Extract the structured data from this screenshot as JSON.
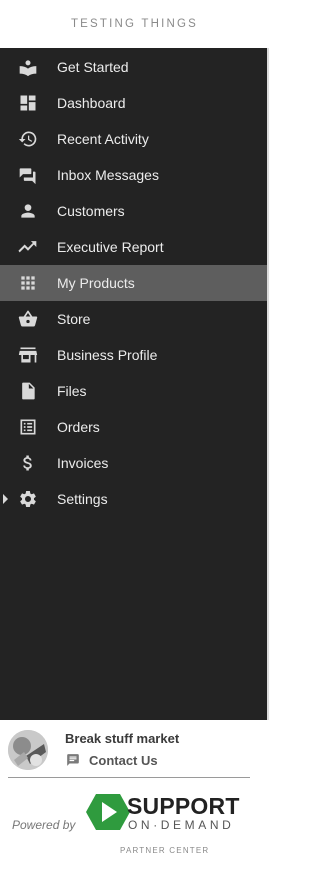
{
  "header": {
    "title": "TESTING THINGS"
  },
  "sidebar": {
    "items": [
      {
        "label": "Get Started",
        "icon": "book-icon"
      },
      {
        "label": "Dashboard",
        "icon": "dashboard-icon"
      },
      {
        "label": "Recent Activity",
        "icon": "history-icon"
      },
      {
        "label": "Inbox Messages",
        "icon": "chat-icon"
      },
      {
        "label": "Customers",
        "icon": "person-icon"
      },
      {
        "label": "Executive Report",
        "icon": "trend-icon"
      },
      {
        "label": "My Products",
        "icon": "grid-icon",
        "active": true
      },
      {
        "label": "Store",
        "icon": "basket-icon"
      },
      {
        "label": "Business Profile",
        "icon": "storefront-icon"
      },
      {
        "label": "Files",
        "icon": "file-icon"
      },
      {
        "label": "Orders",
        "icon": "list-icon"
      },
      {
        "label": "Invoices",
        "icon": "dollar-icon"
      },
      {
        "label": "Settings",
        "icon": "gear-icon",
        "expandable": true
      }
    ]
  },
  "footer": {
    "business_name": "Break stuff market",
    "contact_label": "Contact Us",
    "powered_by": "Powered by",
    "brand_name": "SUPPORT",
    "brand_sub": "ON·DEMAND",
    "partner_center": "PARTNER CENTER"
  },
  "colors": {
    "sidebar_bg": "#232323",
    "active_bg": "#5e5e5e",
    "text": "#ececec",
    "icon": "#d9d9d9",
    "brand_green": "#2f9b3e"
  }
}
